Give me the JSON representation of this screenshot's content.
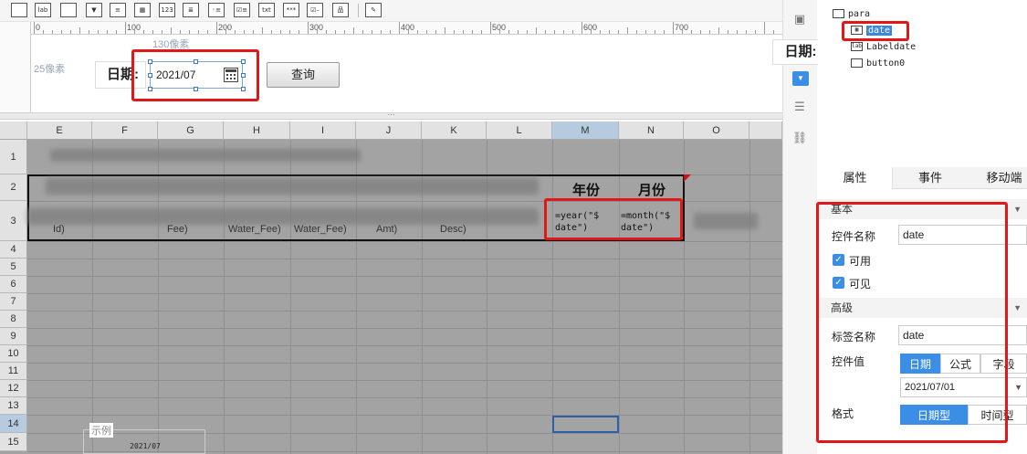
{
  "toolbar": {
    "icons": [
      {
        "name": "panel-icon",
        "glyph": ""
      },
      {
        "name": "label-widget-icon",
        "glyph": "lab"
      },
      {
        "name": "button-widget-icon",
        "glyph": ""
      },
      {
        "name": "dropdown-widget-icon",
        "glyph": "▼"
      },
      {
        "name": "tree-dropdown-icon",
        "glyph": "≡"
      },
      {
        "name": "date-widget-icon",
        "glyph": "▦"
      },
      {
        "name": "number-widget-icon",
        "glyph": "123"
      },
      {
        "name": "list-widget-icon",
        "glyph": "≣"
      },
      {
        "name": "radio-group-icon",
        "glyph": "◦≡"
      },
      {
        "name": "checkbox-group-icon",
        "glyph": "☑≡"
      },
      {
        "name": "text-widget-icon",
        "glyph": "txt"
      },
      {
        "name": "password-widget-icon",
        "glyph": "***"
      },
      {
        "name": "checkbox-widget-icon",
        "glyph": "☑–"
      },
      {
        "name": "tree-widget-icon",
        "glyph": "品"
      },
      {
        "name": "edit-widget-icon",
        "glyph": "✎"
      }
    ]
  },
  "ruler": {
    "ticks": [
      "0",
      "100",
      "200",
      "300",
      "400",
      "500",
      "600",
      "700"
    ]
  },
  "param": {
    "width_hint": "130像素",
    "height_hint": "25像素",
    "date_label": "日期:",
    "date_value": "2021/07",
    "query_label": "查询"
  },
  "sheet": {
    "columns": [
      "E",
      "F",
      "G",
      "H",
      "I",
      "J",
      "K",
      "L",
      "M",
      "N",
      "O"
    ],
    "rows": [
      "1",
      "2",
      "3",
      "4",
      "5",
      "6",
      "7",
      "8",
      "9",
      "10",
      "11",
      "12",
      "13",
      "14",
      "15"
    ],
    "selected_column": "M",
    "selected_row": "14",
    "header_year": "年份",
    "header_month": "月份",
    "formula_year": [
      "=year(\"$",
      "date\")"
    ],
    "formula_month": [
      "=month(\"$",
      "date\")"
    ],
    "row3_fragments": [
      "Id)",
      "Fee)",
      "Water_Fee)",
      "Water_Fee)",
      "Amt)",
      "Desc)"
    ]
  },
  "side": {
    "float_label": "日期:"
  },
  "tree": {
    "items": [
      {
        "name": "tree-item-para",
        "icon": "",
        "label": "para",
        "indent": 0
      },
      {
        "name": "tree-item-date",
        "icon": "▦",
        "label": "date",
        "indent": 1,
        "selected": true
      },
      {
        "name": "tree-item-labeldate",
        "icon": "lab",
        "label": "Labeldate",
        "indent": 1
      },
      {
        "name": "tree-item-button0",
        "icon": "",
        "label": "button0",
        "indent": 1
      }
    ]
  },
  "props": {
    "tabs": [
      "属性",
      "事件",
      "移动端"
    ],
    "section_basic": "基本",
    "control_name_label": "控件名称",
    "control_name_value": "date",
    "enabled_label": "可用",
    "visible_label": "可见",
    "section_advanced": "高级",
    "tag_name_label": "标签名称",
    "tag_name_value": "date",
    "control_value_label": "控件值",
    "value_types": [
      "日期",
      "公式",
      "字段"
    ],
    "value_date": "2021/07/01",
    "format_label": "格式",
    "format_types": [
      "日期型",
      "时间型"
    ],
    "example_legend": "示例",
    "example_value": "2021/07"
  },
  "colors": {
    "accent": "#3a8ee6",
    "highlight": "#e01818"
  }
}
